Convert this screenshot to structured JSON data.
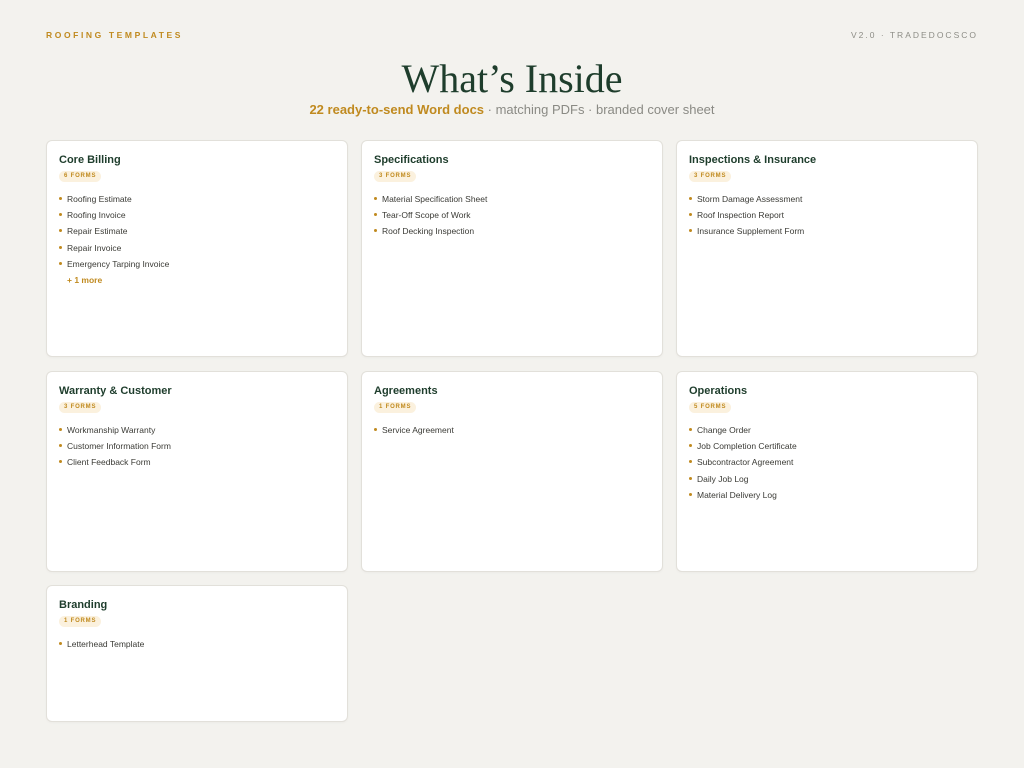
{
  "header": {
    "left_label": "ROOFING TEMPLATES",
    "right_label": "V2.0 · TRADEDOCSCO"
  },
  "hero": {
    "title": "What’s Inside",
    "subtitle_strong": "22 ready-to-send Word docs",
    "subtitle_rest": " · matching PDFs · branded cover sheet"
  },
  "colors": {
    "background": "#f3f2ee",
    "accent": "#c08a1f",
    "title": "#1e3d2c",
    "badge_bg": "#fbf1de"
  },
  "cards": [
    {
      "title": "Core Billing",
      "badge": "6 FORMS",
      "items": [
        "Roofing Estimate",
        "Roofing Invoice",
        "Repair Estimate",
        "Repair Invoice",
        "Emergency Tarping Invoice"
      ],
      "more": "+ 1 more"
    },
    {
      "title": "Specifications",
      "badge": "3 FORMS",
      "items": [
        "Material Specification Sheet",
        "Tear-Off Scope of Work",
        "Roof Decking Inspection"
      ]
    },
    {
      "title": "Inspections & Insurance",
      "badge": "3 FORMS",
      "items": [
        "Storm Damage Assessment",
        "Roof Inspection Report",
        "Insurance Supplement Form"
      ]
    },
    {
      "title": "Warranty & Customer",
      "badge": "3 FORMS",
      "items": [
        "Workmanship Warranty",
        "Customer Information Form",
        "Client Feedback Form"
      ]
    },
    {
      "title": "Agreements",
      "badge": "1 FORMS",
      "items": [
        "Service Agreement"
      ]
    },
    {
      "title": "Operations",
      "badge": "5 FORMS",
      "items": [
        "Change Order",
        "Job Completion Certificate",
        "Subcontractor Agreement",
        "Daily Job Log",
        "Material Delivery Log"
      ]
    },
    {
      "title": "Branding",
      "badge": "1 FORMS",
      "items": [
        "Letterhead Template"
      ]
    }
  ]
}
